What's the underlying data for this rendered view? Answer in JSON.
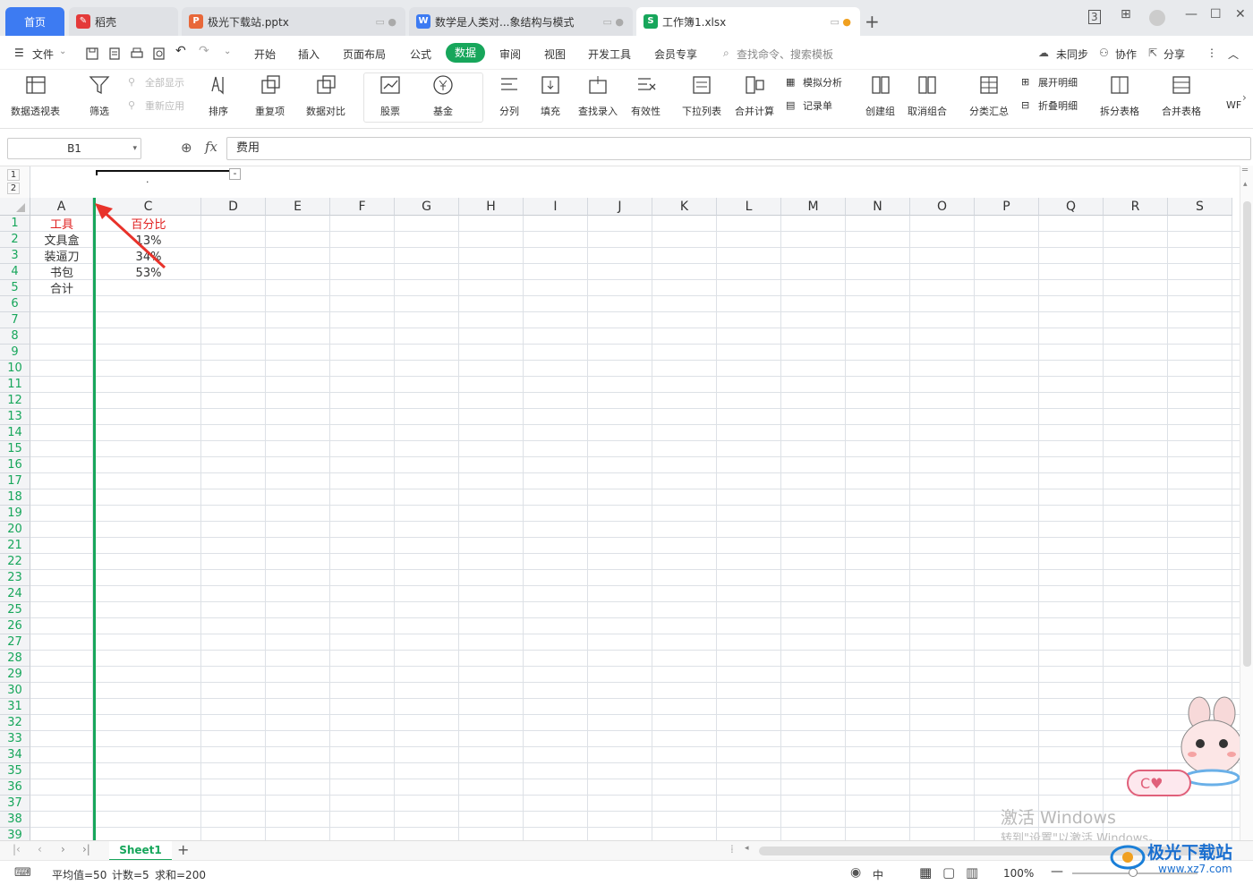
{
  "tabs": {
    "home": "首页",
    "daoke": "稻壳",
    "ppt": "极光下载站.pptx",
    "doc": "数学是人类对...象结构与模式",
    "xls": "工作簿1.xlsx"
  },
  "menu": {
    "file": "文件",
    "items": [
      "开始",
      "插入",
      "页面布局",
      "公式",
      "数据",
      "审阅",
      "视图",
      "开发工具",
      "会员专享"
    ],
    "search": "查找命令、搜索模板",
    "sync": "未同步",
    "collab": "协作",
    "share": "分享"
  },
  "ribbon": {
    "pivot": "数据透视表",
    "filter": "筛选",
    "show_all": "全部显示",
    "reapply": "重新应用",
    "sort": "排序",
    "dup": "重复项",
    "compare": "数据对比",
    "stock": "股票",
    "fund": "基金",
    "split": "分列",
    "fill": "填充",
    "lookup": "查找录入",
    "validity": "有效性",
    "dropdown": "下拉列表",
    "consolidate": "合并计算",
    "simulate": "模拟分析",
    "record": "记录单",
    "group": "创建组",
    "ungroup": "取消组合",
    "subtotal": "分类汇总",
    "expand": "展开明细",
    "collapse": "折叠明细",
    "split_table": "拆分表格",
    "merge_table": "合并表格",
    "more": "WF"
  },
  "formula": {
    "cell": "B1",
    "fx": "fx",
    "value": "费用"
  },
  "outline": {
    "level1": "1",
    "level2": "2",
    "collapse": "-",
    "dot": "."
  },
  "columns": [
    "A",
    "C",
    "D",
    "E",
    "F",
    "G",
    "H",
    "I",
    "J",
    "K",
    "L",
    "M",
    "N",
    "O",
    "P",
    "Q",
    "R",
    "S"
  ],
  "rows": [
    "1",
    "2",
    "3",
    "4",
    "5",
    "6",
    "7",
    "8",
    "9",
    "10",
    "11",
    "12",
    "13",
    "14",
    "15",
    "16",
    "17",
    "18",
    "19",
    "20",
    "21",
    "22",
    "23",
    "24",
    "25",
    "26",
    "27",
    "28",
    "29",
    "30",
    "31",
    "32",
    "33",
    "34",
    "35",
    "36",
    "37",
    "38",
    "39"
  ],
  "cells": {
    "a1": "工具",
    "a2": "文具盒",
    "a3": "装逼刀",
    "a4": "书包",
    "a5": "合计",
    "c1": "百分比",
    "c2": "13%",
    "c3": "34%",
    "c4": "53%"
  },
  "sheet": {
    "name": "Sheet1",
    "add": "+"
  },
  "status": {
    "avg": "平均值=50",
    "count": "计数=5",
    "sum": "求和=200",
    "zoom": "100%",
    "lang": "中"
  },
  "watermark": {
    "line1": "激活 Windows",
    "line2": "转到\"设置\"以激活 Windows。"
  },
  "logo": {
    "text": "极光下载站",
    "url": "www.xz7.com"
  },
  "colors": {
    "accent": "#17a65b",
    "home_tab": "#3d7bf2",
    "header_red": "#e02020",
    "arrow": "#e8322a"
  }
}
